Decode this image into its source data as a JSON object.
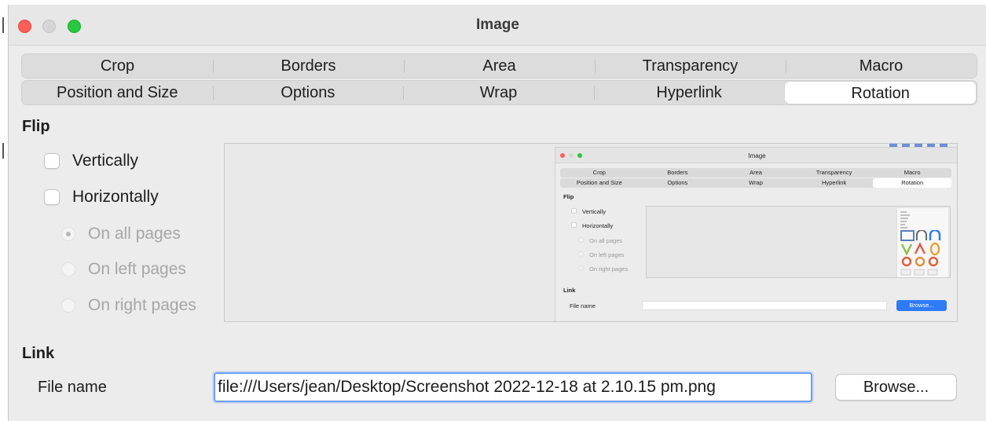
{
  "window": {
    "title": "Image"
  },
  "tabs": {
    "row1": [
      "Crop",
      "Borders",
      "Area",
      "Transparency",
      "Macro"
    ],
    "row2": [
      "Position and Size",
      "Options",
      "Wrap",
      "Hyperlink",
      "Rotation"
    ],
    "active": "Rotation"
  },
  "flip": {
    "title": "Flip",
    "vertically": {
      "label": "Vertically",
      "checked": false
    },
    "horizontally": {
      "label": "Horizontally",
      "checked": false
    },
    "radios": [
      {
        "label": "On all pages",
        "selected": true
      },
      {
        "label": "On left pages",
        "selected": false
      },
      {
        "label": "On right pages",
        "selected": false
      }
    ]
  },
  "preview": {
    "mini_dialog": {
      "title": "Image",
      "row1": [
        "Crop",
        "Borders",
        "Area",
        "Transparency",
        "Macro"
      ],
      "row2": [
        "Position and Size",
        "Options",
        "Wrap",
        "Hyperlink",
        "Rotation"
      ],
      "flip_title": "Flip",
      "vertically": "Vertically",
      "horizontally": "Horizontally",
      "on_all": "On all pages",
      "on_left": "On left pages",
      "on_right": "On right pages",
      "link_title": "Link",
      "file_label": "File name",
      "browse": "Browse..."
    }
  },
  "link": {
    "title": "Link",
    "file_label": "File name",
    "file_value": "file:///Users/jean/Desktop/Screenshot 2022-12-18 at 2.10.15 pm.png",
    "browse_label": "Browse..."
  },
  "colors": {
    "accent": "#6c9ef8",
    "close": "#fe5f57",
    "maximize": "#28c840",
    "mini_browse": "#2f7bf5"
  }
}
